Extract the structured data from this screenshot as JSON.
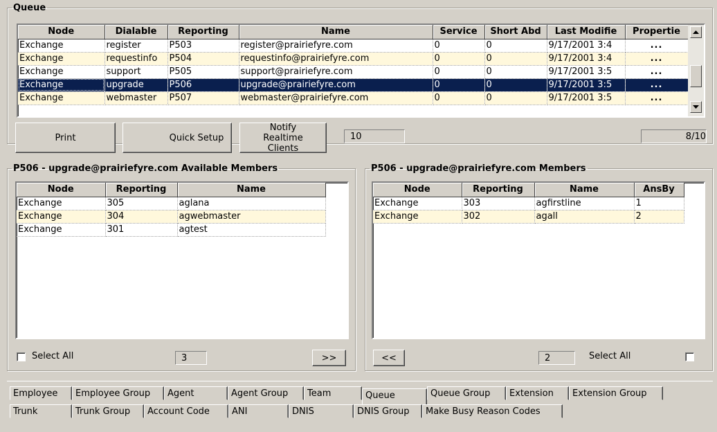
{
  "queue": {
    "legend": "Queue",
    "columns": [
      "Node",
      "Dialable",
      "Reporting",
      "Name",
      "Service",
      "Short Abd",
      "Last Modifie",
      "Propertie"
    ],
    "rows": [
      [
        "Exchange",
        "register",
        "P503",
        "register@prairiefyre.com",
        "0",
        "0",
        "9/17/2001 3:4",
        "..."
      ],
      [
        "Exchange",
        "requestinfo",
        "P504",
        "requestinfo@prairiefyre.com",
        "0",
        "0",
        "9/17/2001 3:4",
        "..."
      ],
      [
        "Exchange",
        "support",
        "P505",
        "support@prairiefyre.com",
        "0",
        "0",
        "9/17/2001 3:5",
        "..."
      ],
      [
        "Exchange",
        "upgrade",
        "P506",
        "upgrade@prairiefyre.com",
        "0",
        "0",
        "9/17/2001 3:5",
        "..."
      ],
      [
        "Exchange",
        "webmaster",
        "P507",
        "webmaster@prairiefyre.com",
        "0",
        "0",
        "9/17/2001 3:5",
        "..."
      ]
    ],
    "print_label": "Print",
    "quick_setup_label": "Quick Setup",
    "notify_label": "Notify Realtime Clients",
    "count": "10",
    "position": "8/10"
  },
  "available": {
    "legend": "P506 - upgrade@prairiefyre.com Available Members",
    "columns": [
      "Node",
      "Reporting",
      "Name"
    ],
    "rows": [
      [
        "Exchange",
        "305",
        "aglana"
      ],
      [
        "Exchange",
        "304",
        "agwebmaster"
      ],
      [
        "Exchange",
        "301",
        "agtest"
      ]
    ],
    "select_all_label": "Select All",
    "count": "3",
    "add_label": ">>"
  },
  "members": {
    "legend": "P506 - upgrade@prairiefyre.com Members",
    "columns": [
      "Node",
      "Reporting",
      "Name",
      "AnsBy"
    ],
    "rows": [
      [
        "Exchange",
        "303",
        "agfirstline",
        "1"
      ],
      [
        "Exchange",
        "302",
        "agall",
        "2"
      ]
    ],
    "remove_label": "<<",
    "count": "2",
    "select_all_label": "Select All"
  },
  "tabs": {
    "row1": [
      "Employee",
      "Employee Group",
      "Agent",
      "Agent Group",
      "Team",
      "Queue",
      "Queue Group",
      "Extension",
      "Extension Group"
    ],
    "row2": [
      "Trunk",
      "Trunk Group",
      "Account Code",
      "ANI",
      "DNIS",
      "DNIS Group",
      "Make Busy Reason Codes"
    ],
    "active": "Queue"
  },
  "colors": {
    "selected_row": "#0a1f4e",
    "alt_row": "#fff8dc",
    "face": "#d4d0c8"
  }
}
